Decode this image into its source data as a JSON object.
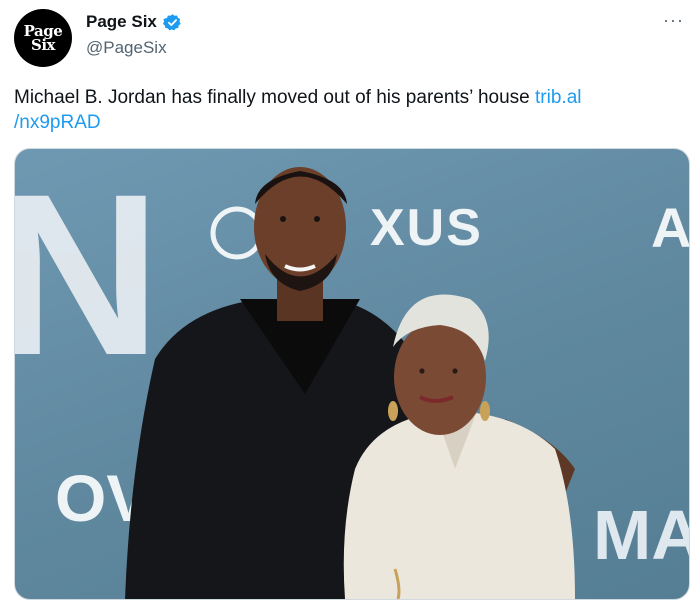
{
  "account": {
    "avatar_text_line1": "Page",
    "avatar_text_line2": "Six",
    "display_name": "Page Six",
    "handle": "@PageSix",
    "verified_icon": "verified-badge-icon"
  },
  "menu": {
    "more_label": "···"
  },
  "tweet": {
    "text": "Michael B. Jordan has finally moved out of his parents’ house ",
    "link_line1": "trib.al",
    "link_line2": "/nx9pRAD"
  },
  "media": {
    "backdrop_texts": {
      "brand": "XUS",
      "corner_left": "N",
      "corner_right": "A",
      "bottom_left": "OV",
      "bottom_right": "MA"
    }
  },
  "colors": {
    "link": "#1d9bf0",
    "verified": "#1d9bf0",
    "backdrop": "#6f98b2"
  }
}
